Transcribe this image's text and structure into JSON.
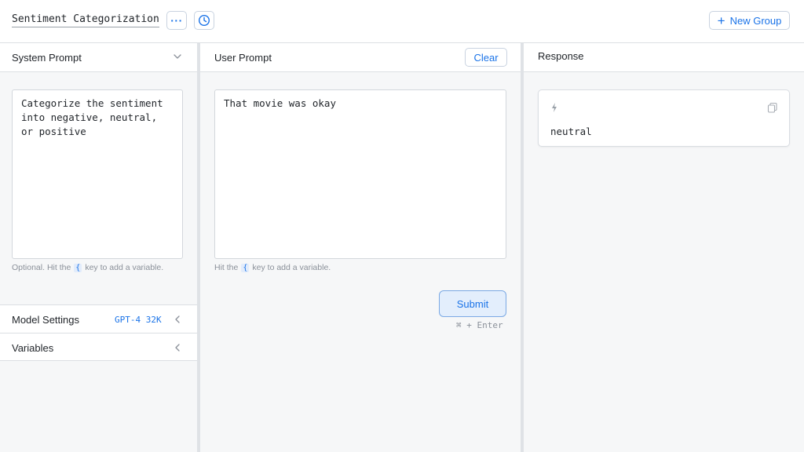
{
  "header": {
    "title": "Sentiment Categorization",
    "more_label": "···",
    "new_group_label": "New Group"
  },
  "system_prompt": {
    "title": "System Prompt",
    "text": "Categorize the sentiment\ninto negative, neutral,\nor positive",
    "hint_before": "Optional. Hit the",
    "hint_key": "{",
    "hint_after": "key to add a variable."
  },
  "model_settings": {
    "label": "Model Settings",
    "value": "GPT-4 32K"
  },
  "variables": {
    "label": "Variables"
  },
  "user_prompt": {
    "title": "User Prompt",
    "clear_label": "Clear",
    "text": "That movie was okay",
    "hint_before": "Hit the",
    "hint_key": "{",
    "hint_after": "key to add a variable.",
    "submit_label": "Submit",
    "shortcut": "⌘ + Enter"
  },
  "response": {
    "title": "Response",
    "text": "neutral"
  },
  "colors": {
    "accent": "#1a73e8",
    "panel_bg": "#f6f7f8",
    "border": "#dcdfe3"
  },
  "icons": [
    "more-icon",
    "history-icon",
    "plus-icon",
    "chevron-down-icon",
    "chevron-left-icon",
    "bolt-icon",
    "copy-icon"
  ]
}
